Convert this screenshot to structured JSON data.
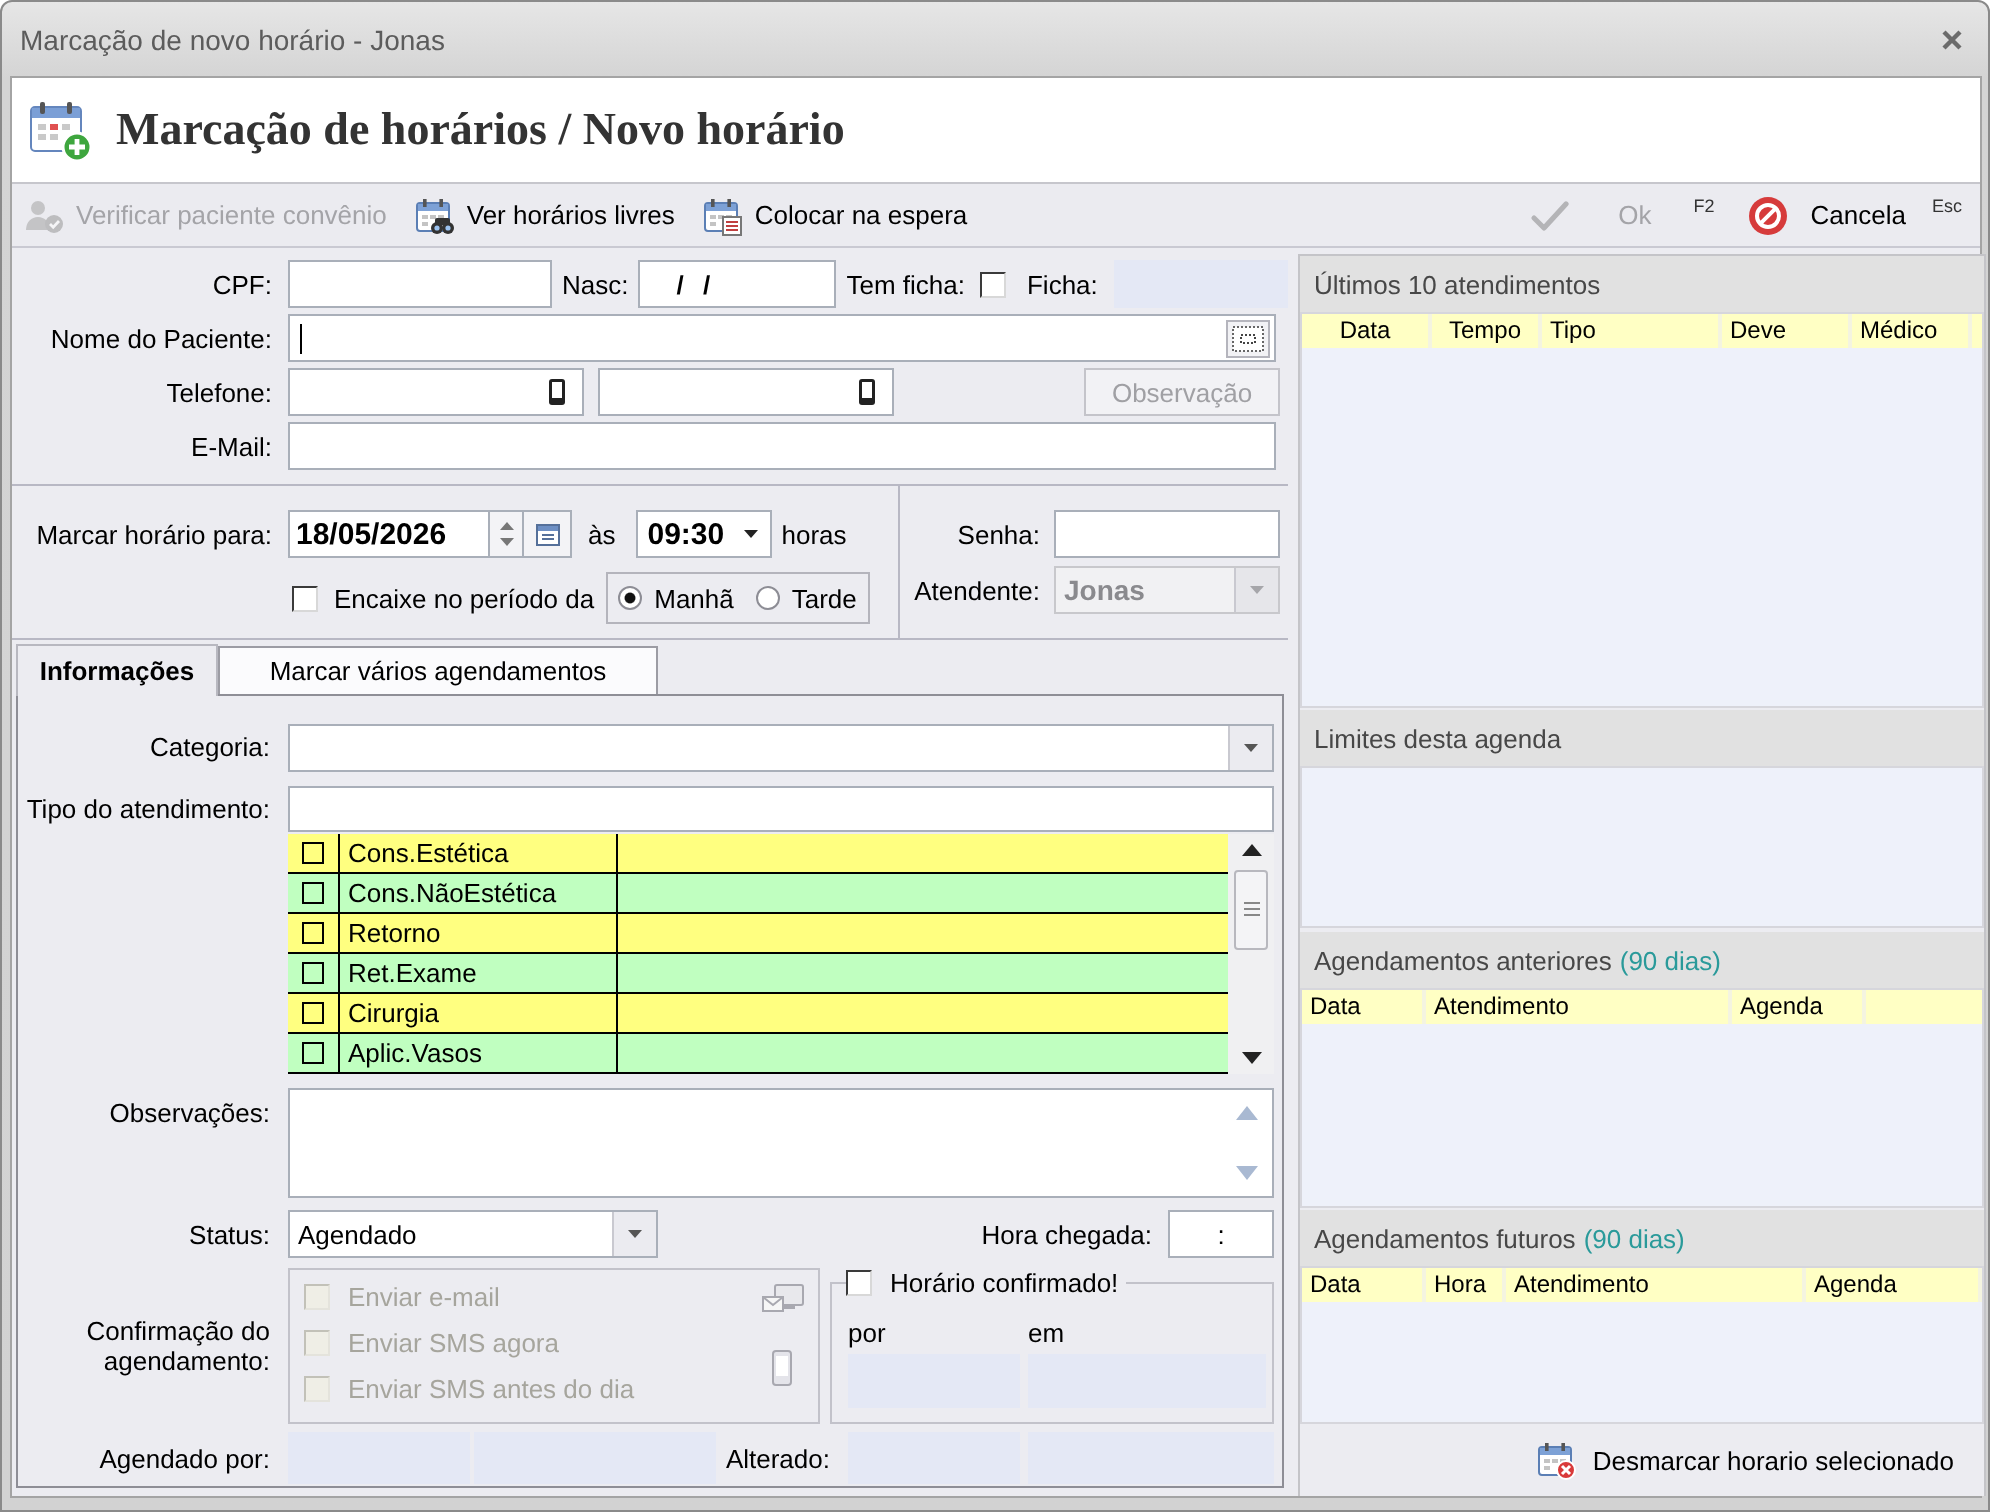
{
  "window": {
    "title": "Marcação de novo horário - Jonas"
  },
  "header": {
    "title": "Marcação de horários / Novo horário"
  },
  "toolbar": {
    "left": [
      {
        "kind": "verify",
        "label": "Verificar paciente convênio",
        "disabled": true
      },
      {
        "kind": "free",
        "label": "Ver horários livres",
        "disabled": false
      },
      {
        "kind": "wait",
        "label": "Colocar na espera",
        "disabled": false
      }
    ],
    "right": [
      {
        "kind": "ok",
        "label": "Ok",
        "shortcut": "F2",
        "disabled": true
      },
      {
        "kind": "cancel",
        "label": "Cancela",
        "shortcut": "Esc",
        "disabled": false
      }
    ]
  },
  "patient": {
    "cpf": {
      "label": "CPF:"
    },
    "birth": {
      "label": "Nasc:",
      "value": "/ /"
    },
    "has_record": {
      "label": "Tem ficha:",
      "checked": false
    },
    "record": {
      "label": "Ficha:"
    },
    "name": {
      "label": "Nome do Paciente:",
      "focused": true
    },
    "phone": {
      "label": "Telefone:"
    },
    "observation": {
      "label": "Observação",
      "disabled": true
    },
    "email": {
      "label": "E-Mail:"
    }
  },
  "schedule": {
    "label": "Marcar horário para:",
    "date": "18/05/2026",
    "at": "às",
    "time": "09:30",
    "unit": "horas",
    "fit_in": {
      "label": "Encaixe no período da",
      "checked": false
    },
    "periods": [
      {
        "label": "Manhã",
        "selected": true
      },
      {
        "label": "Tarde",
        "selected": false
      }
    ],
    "password": {
      "label": "Senha:"
    },
    "attendant": {
      "label": "Atendente:",
      "value": "Jonas",
      "disabled": true
    }
  },
  "tabs": [
    {
      "label": "Informações",
      "selected": true
    },
    {
      "label": "Marcar vários agendamentos",
      "selected": false
    }
  ],
  "info": {
    "category": {
      "label": "Categoria:"
    },
    "service_type": {
      "label": "Tipo do atendimento:"
    },
    "services": [
      {
        "name": "Cons.Estética",
        "checked": false,
        "color": "#ffff80"
      },
      {
        "name": "Cons.NãoEstética",
        "checked": false,
        "color": "#c0ffc0"
      },
      {
        "name": "Retorno",
        "checked": false,
        "color": "#ffff80"
      },
      {
        "name": "Ret.Exame",
        "checked": false,
        "color": "#c0ffc0"
      },
      {
        "name": "Cirurgia",
        "checked": false,
        "color": "#ffff80"
      },
      {
        "name": "Aplic.Vasos",
        "checked": false,
        "color": "#c0ffc0"
      }
    ],
    "notes": {
      "label": "Observações:"
    },
    "status": {
      "label": "Status:",
      "value": "Agendado"
    },
    "arrival": {
      "label": "Hora chegada:",
      "value": ":"
    },
    "confirmation": {
      "label": "Confirmação do agendamento:",
      "options": [
        {
          "label": "Enviar e-mail",
          "checked": false,
          "disabled": true
        },
        {
          "label": "Enviar SMS agora",
          "checked": false,
          "disabled": true
        },
        {
          "label": "Enviar SMS antes do dia",
          "checked": false,
          "disabled": true
        }
      ],
      "confirmed": {
        "label": "Horário confirmado!",
        "checked": false
      },
      "by": "por",
      "on": "em"
    },
    "scheduled_by": {
      "label": "Agendado por:"
    },
    "changed": {
      "label": "Alterado:"
    }
  },
  "history": {
    "panels": [
      {
        "title": "Últimos 10 atendimentos",
        "columns": [
          "Data",
          "Tempo",
          "Tipo",
          "Deve",
          "Médico"
        ]
      },
      {
        "title": "Limites desta agenda"
      },
      {
        "title": "Agendamentos anteriores",
        "note": "(90 dias)",
        "columns": [
          "Data",
          "Atendimento",
          "Agenda"
        ]
      },
      {
        "title": "Agendamentos futuros",
        "note": "(90 dias)",
        "columns": [
          "Data",
          "Hora",
          "Atendimento",
          "Agenda"
        ]
      }
    ],
    "unschedule": {
      "label": "Desmarcar horario selecionado"
    }
  }
}
